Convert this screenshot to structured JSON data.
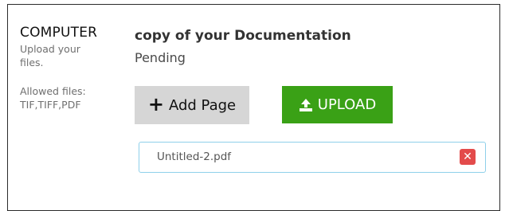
{
  "source": {
    "title": "COMPUTER",
    "hint": "Upload your files.",
    "allowed_files": "Allowed files: TIF,TIFF,PDF"
  },
  "document": {
    "title": "copy of your Documentation",
    "status": "Pending"
  },
  "buttons": {
    "add_page_label": "Add Page",
    "add_page_icon": "plus-icon",
    "upload_label": "UPLOAD",
    "upload_icon": "upload-icon"
  },
  "files": [
    {
      "name": "Untitled-2.pdf",
      "remove_icon": "close-icon"
    }
  ],
  "colors": {
    "upload_button": "#3aa116",
    "add_button": "#d6d6d6",
    "remove_button": "#e34b4b",
    "file_border": "#8fd0ea"
  }
}
